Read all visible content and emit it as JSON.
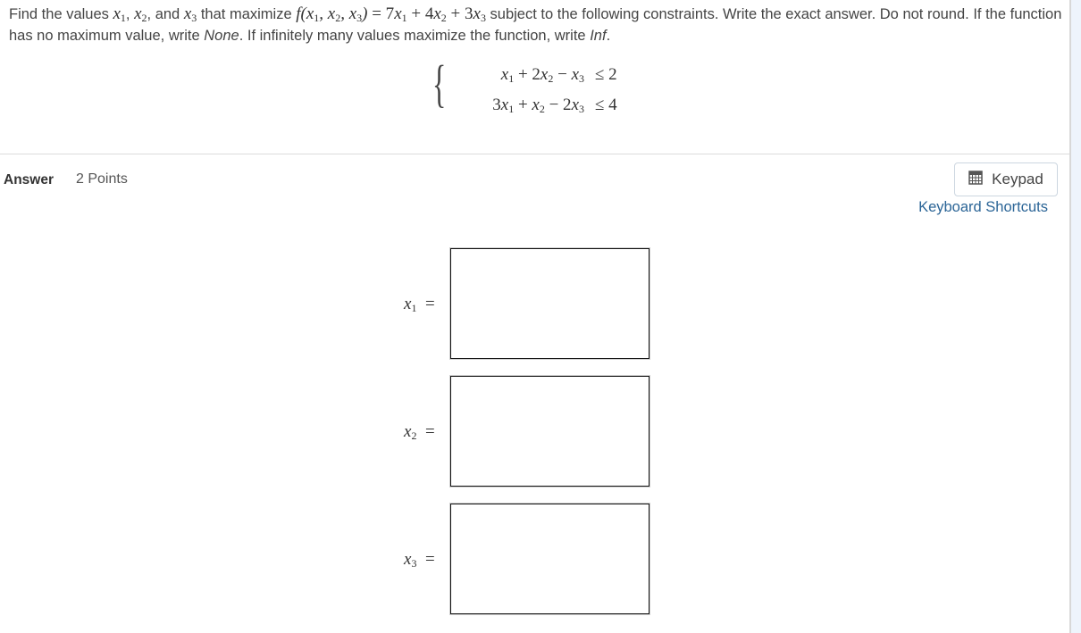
{
  "question": {
    "text_1": "Find the values ",
    "x1": "x",
    "x2": "x",
    "x3": "x",
    "sub1": "1",
    "sub2": "2",
    "sub3": "3",
    "text_2": ", ",
    "text_3": ", and ",
    "text_4": " that maximize ",
    "func": "f(",
    "func_args_sep": ", ",
    "func_close": ")",
    "objective": " = 7x₁ + 4x₂ + 3x₃",
    "text_5": " subject to the following constraints. Write the exact answer. Do not round. If the function has no maximum value, write ",
    "none_word": "None",
    "text_6": ". If infinitely many values maximize the function, write ",
    "inf_word": "Inf",
    "text_7": "."
  },
  "constraints": [
    {
      "lhs": "x₁ + 2x₂ − x₃",
      "rel": "≤ 2"
    },
    {
      "lhs": "3x₁ + x₂ − 2x₃",
      "rel": "≤ 4"
    }
  ],
  "answer": {
    "label": "Answer",
    "points": "2 Points",
    "keypad_label": "Keypad",
    "keypad_icon": "calculator-icon",
    "shortcuts_label": "Keyboard Shortcuts"
  },
  "fields": [
    {
      "label": "x₁ =",
      "value": ""
    },
    {
      "label": "x₂ =",
      "value": ""
    },
    {
      "label": "x₃ =",
      "value": ""
    }
  ]
}
